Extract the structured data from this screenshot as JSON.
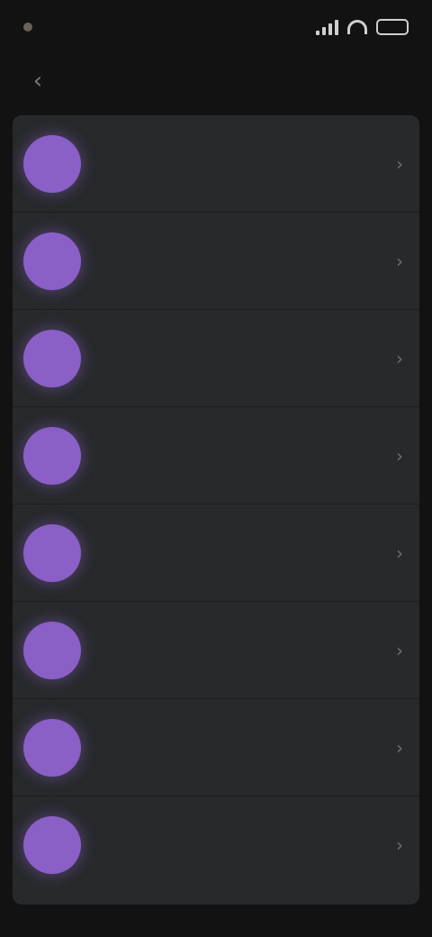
{
  "status_bar": {
    "time": ""
  },
  "header": {
    "title": "",
    "back_glyph": "‹"
  },
  "icons": {
    "back": "chevron-left-icon",
    "signal": "signal-icon",
    "wifi": "wifi-icon",
    "battery": "battery-icon",
    "row_chevron": "chevron-right-icon"
  },
  "colors": {
    "background": "#121212",
    "list_background": "#26282a",
    "avatar_accent": "#8a5fc6"
  },
  "list": {
    "items": [
      {
        "initial": "",
        "title": "",
        "subtitle": "",
        "time": "",
        "chevron": "›"
      },
      {
        "initial": "",
        "title": "",
        "subtitle": "",
        "time": "",
        "chevron": "›"
      },
      {
        "initial": "",
        "title": "",
        "subtitle": "",
        "time": "",
        "chevron": "›"
      },
      {
        "initial": "",
        "title": "",
        "subtitle": "",
        "time": "",
        "chevron": "›"
      },
      {
        "initial": "",
        "title": "",
        "subtitle": "",
        "time": "",
        "chevron": "›"
      },
      {
        "initial": "",
        "title": "",
        "subtitle": "",
        "time": "",
        "chevron": "›"
      },
      {
        "initial": "",
        "title": "",
        "subtitle": "",
        "time": "",
        "chevron": "›"
      },
      {
        "initial": "",
        "title": "",
        "subtitle": "",
        "time": "",
        "chevron": "›"
      }
    ]
  }
}
